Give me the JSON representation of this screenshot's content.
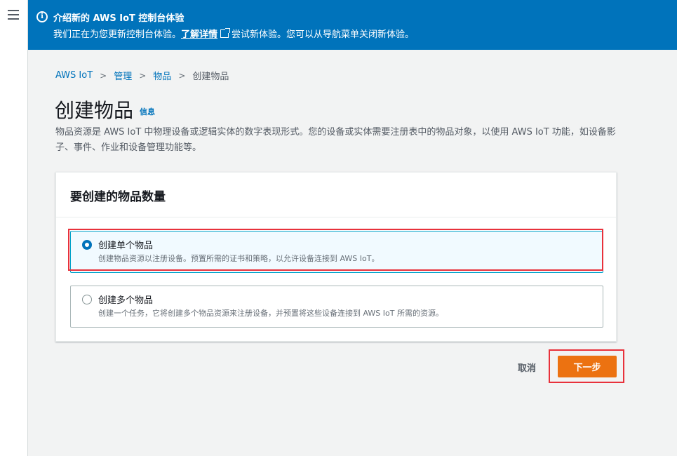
{
  "nav": {
    "menu_icon": "hamburger-icon"
  },
  "banner": {
    "icon": "info-circle-icon",
    "icon_glyph": "i",
    "title": "介绍新的 AWS IoT 控制台体验",
    "text_before": "我们正在为您更新控制台体验。",
    "link_label": "了解详情",
    "link_icon": "external-link-icon",
    "text_after": "尝试新体验。您可以从导航菜单关闭新体验。"
  },
  "breadcrumb": {
    "items": [
      "AWS IoT",
      "管理",
      "物品"
    ],
    "current": "创建物品",
    "separator": ">"
  },
  "page": {
    "title": "创建物品",
    "info_label": "信息",
    "description": "物品资源是 AWS IoT 中物理设备或逻辑实体的数字表现形式。您的设备或实体需要注册表中的物品对象，以使用 AWS IoT 功能，如设备影子、事件、作业和设备管理功能等。"
  },
  "panel": {
    "header": "要创建的物品数量",
    "options": [
      {
        "label": "创建单个物品",
        "description": "创建物品资源以注册设备。预置所需的证书和策略，以允许设备连接到 AWS IoT。",
        "selected": true
      },
      {
        "label": "创建多个物品",
        "description": "创建一个任务，它将创建多个物品资源来注册设备，并预置将这些设备连接到 AWS IoT 所需的资源。",
        "selected": false
      }
    ]
  },
  "actions": {
    "cancel_label": "取消",
    "next_label": "下一步"
  },
  "colors": {
    "banner": "#0073bb",
    "primary_button": "#ec7211",
    "highlight": "#e8313b",
    "link": "#0073bb"
  }
}
